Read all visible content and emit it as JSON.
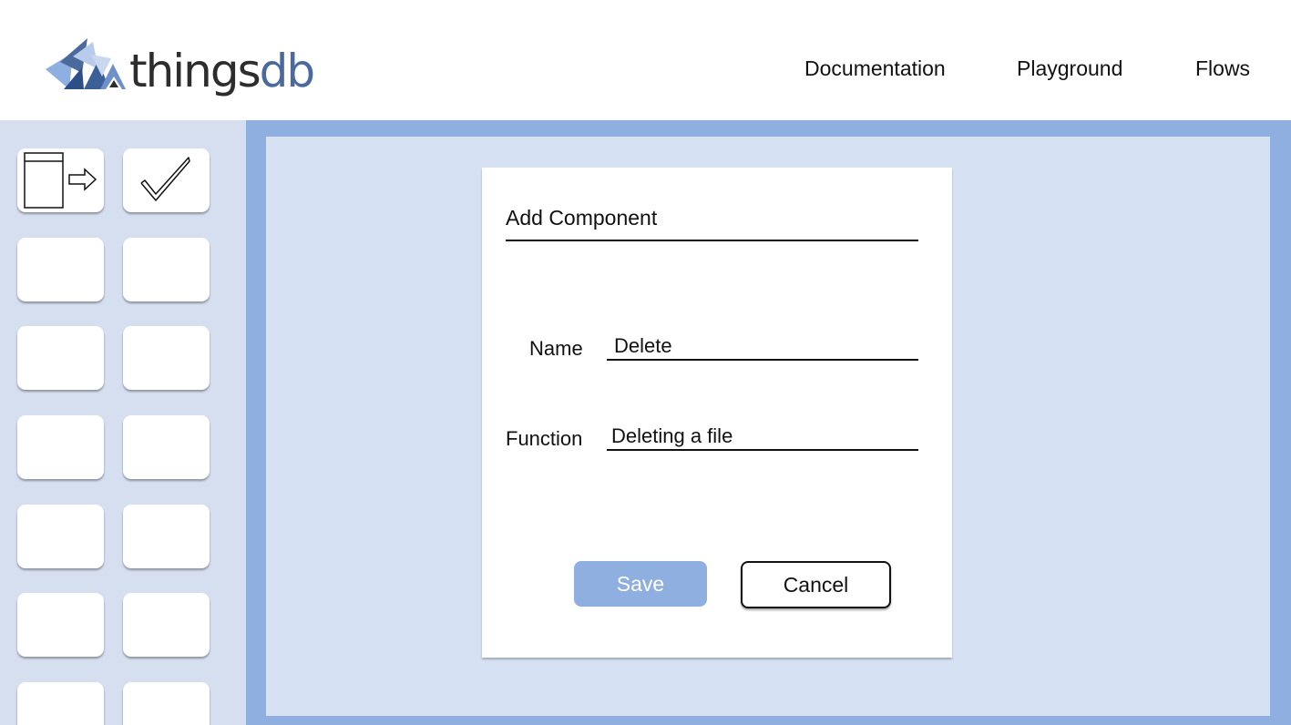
{
  "header": {
    "logo": {
      "text_things": "things",
      "text_db": "db"
    },
    "nav": [
      {
        "label": "Documentation"
      },
      {
        "label": "Playground"
      },
      {
        "label": "Flows"
      }
    ]
  },
  "sidebar": {
    "tiles": [
      {
        "icon": "box-arrow-icon"
      },
      {
        "icon": "checkmark-icon"
      },
      {
        "icon": ""
      },
      {
        "icon": ""
      },
      {
        "icon": ""
      },
      {
        "icon": ""
      },
      {
        "icon": ""
      },
      {
        "icon": ""
      },
      {
        "icon": ""
      },
      {
        "icon": ""
      },
      {
        "icon": ""
      },
      {
        "icon": ""
      },
      {
        "icon": ""
      },
      {
        "icon": ""
      }
    ]
  },
  "dialog": {
    "title": "Add Component",
    "name_label": "Name",
    "name_value": "Delete",
    "function_label": "Function",
    "function_value": "Deleting a file",
    "save_label": "Save",
    "cancel_label": "Cancel"
  },
  "colors": {
    "accent": "#8eafe0",
    "canvas": "#d6e2f4",
    "sidebar": "#d6dff0",
    "logo_db": "#4a6a9e"
  }
}
